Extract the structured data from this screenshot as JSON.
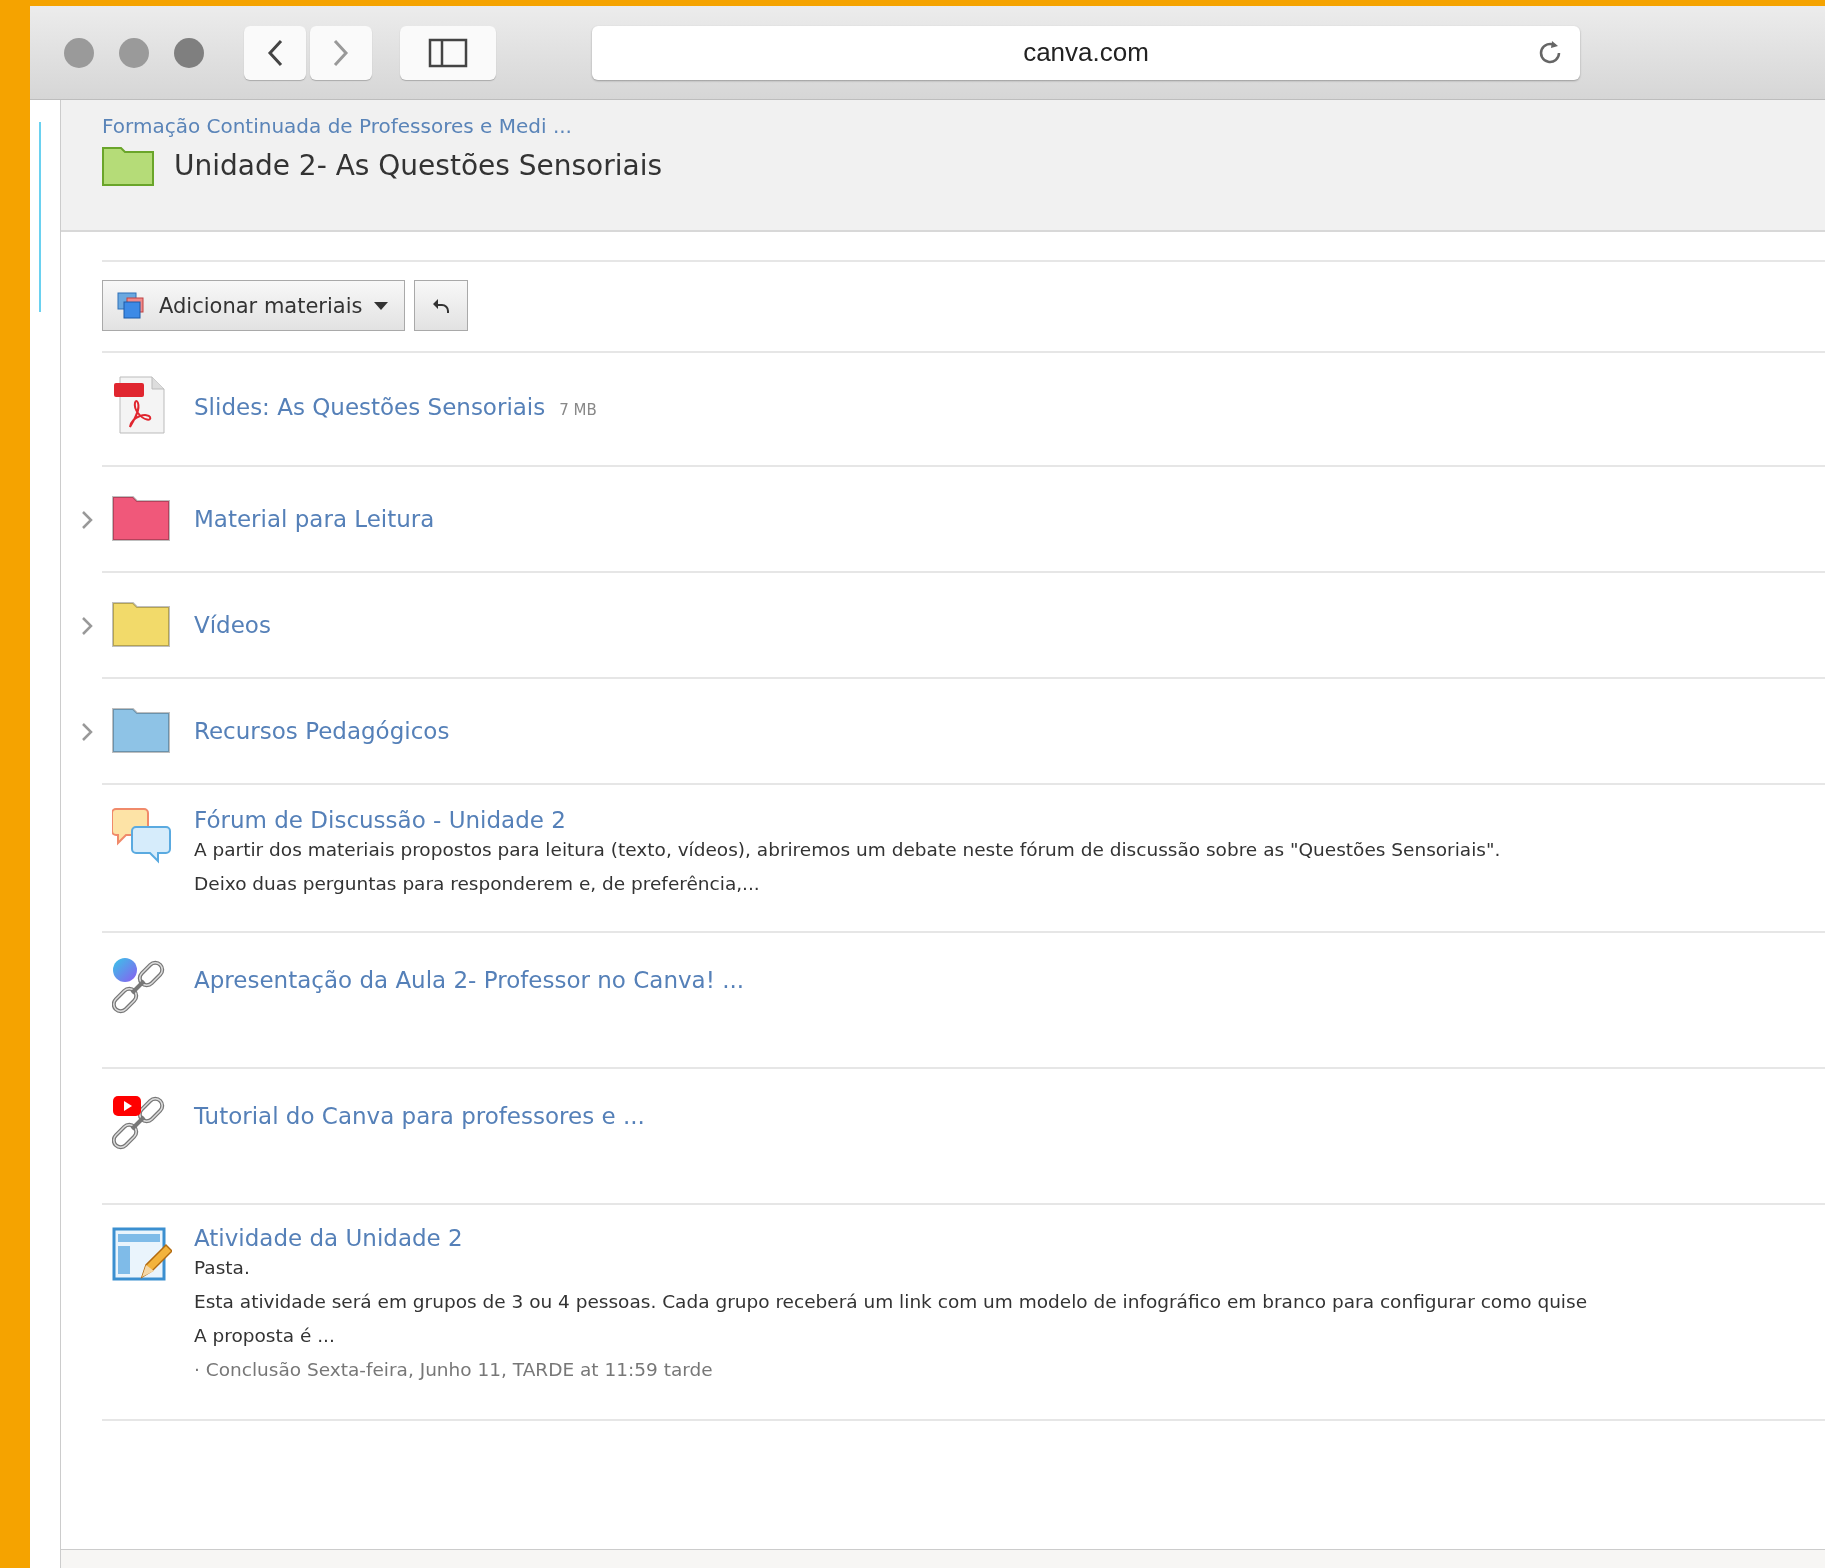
{
  "browser": {
    "url": "canva.com"
  },
  "breadcrumb": "Formação Continuada de Professores e Medi ...",
  "folder_title": "Unidade 2- As Questões Sensoriais",
  "toolbar": {
    "add_button": "Adicionar materiais"
  },
  "items": [
    {
      "kind": "file",
      "title": "Slides: As Questões Sensoriais",
      "size": "7 MB"
    },
    {
      "kind": "folder",
      "title": "Material para Leitura",
      "color": "#f0587a"
    },
    {
      "kind": "folder",
      "title": "Vídeos",
      "color": "#f2da6a"
    },
    {
      "kind": "folder",
      "title": "Recursos Pedagógicos",
      "color": "#8ec3e6"
    },
    {
      "kind": "forum",
      "title": "Fórum de Discussão - Unidade 2",
      "description": [
        "A partir dos materiais propostos para leitura (texto, vídeos), abriremos um debate neste fórum de discussão sobre as \"Questões Sensoriais\".",
        "Deixo duas perguntas para responderem e, de preferência,..."
      ]
    },
    {
      "kind": "link",
      "title": "Apresentação da Aula 2- Professor no Canva! ..."
    },
    {
      "kind": "video",
      "title": "Tutorial do Canva para professores e ..."
    },
    {
      "kind": "assignment",
      "title": "Atividade da Unidade 2",
      "type_label": "Pasta.",
      "description": [
        "Esta atividade será em grupos de 3 ou 4 pessoas. Cada grupo receberá um link com um modelo de infográfico em branco para configurar como quise",
        "A proposta é ..."
      ],
      "due": "· Conclusão Sexta-feira, Junho 11, TARDE at 11:59 tarde"
    }
  ]
}
